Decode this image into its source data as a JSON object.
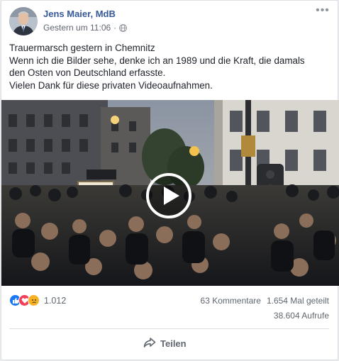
{
  "post": {
    "author": "Jens Maier, MdB",
    "timestamp": "Gestern um 11:06",
    "privacy_icon": "globe-icon",
    "more_label": "•••",
    "text_lines": [
      "Trauermarsch gestern in Chemnitz",
      "Wenn ich die Bilder sehe, denke ich an 1989 und die Kraft, die damals",
      "den Osten von Deutschland erfasste.",
      "Vielen Dank für diese privaten Videoaufnahmen."
    ]
  },
  "stats": {
    "reaction_icons": [
      "like-icon",
      "love-icon",
      "sad-icon"
    ],
    "reaction_count": "1.012",
    "comments": "63 Kommentare",
    "shares": "1.654 Mal geteilt",
    "views": "38.604 Aufrufe"
  },
  "actions": {
    "share_label": "Teilen"
  },
  "colors": {
    "link_blue": "#365899",
    "like_blue": "#1877f2",
    "love_red": "#f33e58",
    "sad_yellow": "#f7b125"
  }
}
